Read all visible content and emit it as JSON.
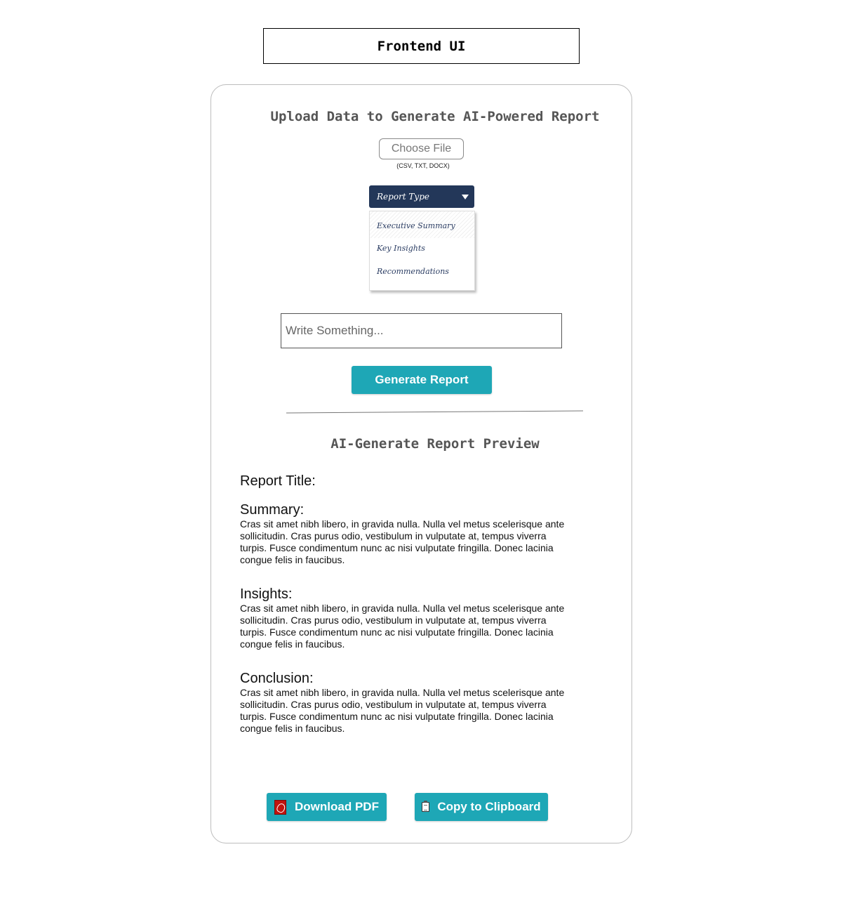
{
  "header": {
    "title": "Frontend UI"
  },
  "upload": {
    "heading": "Upload Data to Generate AI-Powered Report",
    "choose_file_label": "Choose File",
    "file_hint": "(CSV, TXT, DOCX)"
  },
  "report_type": {
    "selected": "Report Type",
    "options": [
      "Executive Summary",
      "Key Insights",
      "Recommendations"
    ]
  },
  "prompt": {
    "placeholder": "Write Something..."
  },
  "actions": {
    "generate_label": "Generate Report",
    "download_label": "Download PDF",
    "copy_label": "Copy to Clipboard"
  },
  "preview": {
    "heading": "AI-Generate Report Preview",
    "report_title_label": "Report Title:",
    "sections": [
      {
        "heading": "Summary:",
        "body": "Cras sit amet nibh libero, in gravida nulla. Nulla vel metus scelerisque ante sollicitudin. Cras purus odio, vestibulum in vulputate at, tempus viverra turpis. Fusce condimentum nunc ac nisi vulputate fringilla. Donec lacinia congue felis in faucibus."
      },
      {
        "heading": "Insights:",
        "body": "Cras sit amet nibh libero, in gravida nulla. Nulla vel metus scelerisque ante sollicitudin. Cras purus odio, vestibulum in vulputate at, tempus viverra turpis. Fusce condimentum nunc ac nisi vulputate fringilla. Donec lacinia congue felis in faucibus."
      },
      {
        "heading": "Conclusion:",
        "body": "Cras sit amet nibh libero, in gravida nulla. Nulla vel metus scelerisque ante sollicitudin. Cras purus odio, vestibulum in vulputate at, tempus viverra turpis. Fusce condimentum nunc ac nisi vulputate fringilla. Donec lacinia congue felis in faucibus."
      }
    ]
  },
  "colors": {
    "accent": "#1ea7b6",
    "dropdown_bg": "#233759",
    "heading_text": "#555555"
  },
  "icons": {
    "download": "pdf-icon",
    "copy": "clipboard-icon",
    "dropdown": "caret-down-icon"
  }
}
